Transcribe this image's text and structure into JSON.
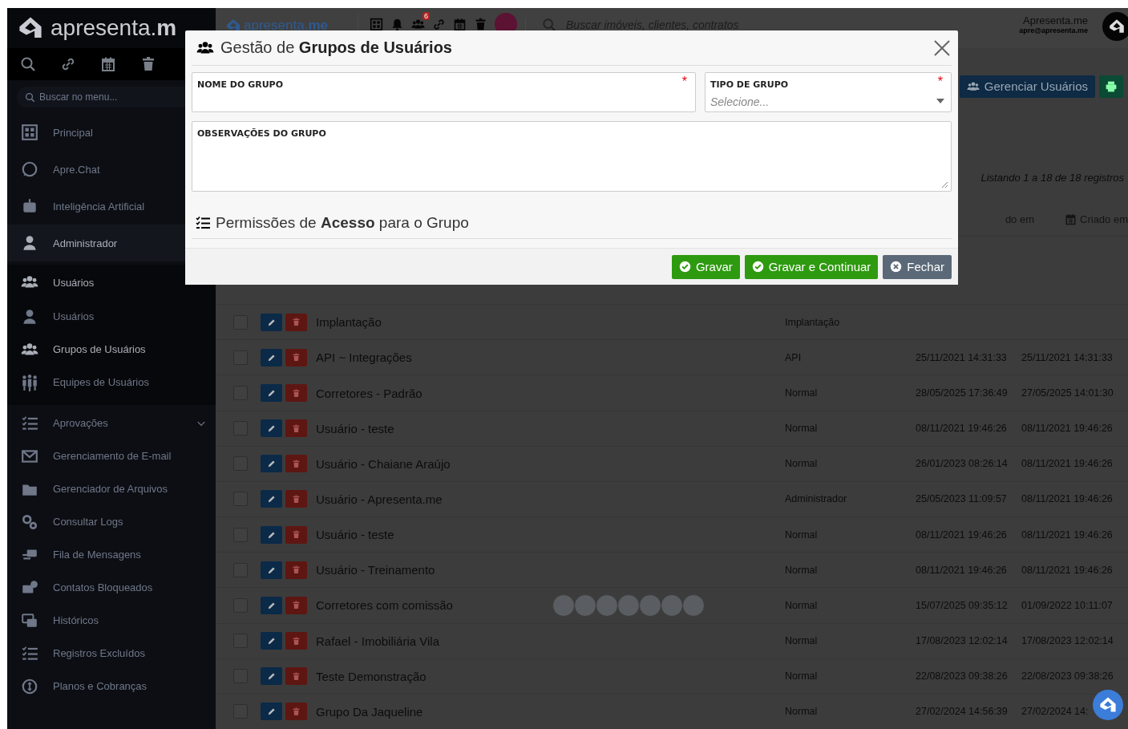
{
  "sidebar": {
    "logo": "apresenta.**m**",
    "search": {
      "placeholder": "Buscar no menu..."
    },
    "items": [
      {
        "kind": "link",
        "label": "Principal",
        "selected": false
      },
      {
        "kind": "link",
        "label": "Apre.Chat",
        "selected": false
      },
      {
        "kind": "link",
        "label": "Inteligência Artificial",
        "selected": false
      },
      {
        "kind": "link",
        "label": "Administrador",
        "selected": true
      },
      {
        "kind": "group",
        "label": "Usuários",
        "expanded": true,
        "children": [
          {
            "label": "Usuários",
            "selected": false
          },
          {
            "label": "Grupos de Usuários",
            "selected": true
          },
          {
            "label": "Equipes de Usuários",
            "selected": false
          }
        ]
      },
      {
        "kind": "group",
        "label": "Aprovações",
        "expanded": false
      },
      {
        "kind": "link",
        "label": "Gerenciamento de E-mail",
        "selected": false
      },
      {
        "kind": "link",
        "label": "Gerenciador de Arquivos",
        "selected": false
      },
      {
        "kind": "link",
        "label": "Consultar Logs",
        "selected": false
      },
      {
        "kind": "link",
        "label": "Fila de Mensagens",
        "selected": false
      },
      {
        "kind": "link",
        "label": "Contatos Bloqueados",
        "selected": false
      },
      {
        "kind": "link",
        "label": "Históricos",
        "selected": false
      },
      {
        "kind": "link",
        "label": "Registros Excluídos",
        "selected": false
      },
      {
        "kind": "link",
        "label": "Planos e Cobranças",
        "selected": false
      }
    ]
  },
  "topbar": {
    "logo": "apresenta.**me**",
    "notification_count": "6",
    "search": {
      "placeholder": "Buscar imóveis, clientes, contratos"
    },
    "user": {
      "name": "Apresenta.me",
      "email": "apre@apresenta.me"
    }
  },
  "toolbar": {
    "buttons": [
      {
        "label": "Gerenciar Usuários"
      }
    ]
  },
  "listing_info": "Listando 1 a 18 de 18 registros",
  "table": {
    "columns": [
      "do em",
      "Criado em"
    ],
    "rows": [
      {
        "checked": false,
        "name": "Implantação",
        "photos": false,
        "type": "Implantação"
      },
      {
        "checked": false,
        "name": "API ~ Integrações",
        "photos": false,
        "type": "API",
        "updated": "25/11/2021 14:31:33",
        "created": "25/11/2021 14:31:33"
      },
      {
        "checked": false,
        "name": "Corretores - Padrão",
        "photos": false,
        "type": "Normal",
        "updated": "28/05/2025 17:36:49",
        "created": "27/05/2025 14:01:30"
      },
      {
        "checked": false,
        "name": "Usuário - teste",
        "photos": false,
        "type": "Normal",
        "updated": "08/11/2021 19:46:26",
        "created": "08/11/2021 19:46:26"
      },
      {
        "checked": false,
        "name": "Usuário - Chaiane Araújo",
        "photos": false,
        "type": "Normal",
        "updated": "26/01/2023 08:26:14",
        "created": "08/11/2021 19:46:26"
      },
      {
        "checked": false,
        "name": "Usuário - Apresenta.me",
        "photos": false,
        "type": "Administrador",
        "updated": "25/05/2023 11:09:57",
        "created": "08/11/2021 19:46:26"
      },
      {
        "checked": false,
        "name": "Usuário - teste",
        "photos": false,
        "type": "Normal",
        "updated": "08/11/2021 19:46:26",
        "created": "08/11/2021 19:46:26"
      },
      {
        "checked": false,
        "name": "Usuário - Treinamento",
        "photos": false,
        "type": "Normal",
        "updated": "08/11/2021 19:46:26",
        "created": "08/11/2021 19:46:26"
      },
      {
        "checked": false,
        "name": "Corretores com comissão",
        "photos": true,
        "type": "Normal",
        "updated": "15/07/2025 09:35:12",
        "created": "01/09/2022 10:11:07"
      },
      {
        "checked": false,
        "name": "Rafael - Imobiliária Vila",
        "photos": false,
        "type": "Normal",
        "updated": "17/08/2023 12:02:14",
        "created": "17/08/2023 12:02:14"
      },
      {
        "checked": false,
        "name": "Teste Demonstração",
        "photos": false,
        "type": "Normal",
        "updated": "22/08/2023 09:38:26",
        "created": "22/08/2023 09:38:26"
      },
      {
        "checked": false,
        "name": "Grupo Da Jaqueline",
        "photos": false,
        "type": "Normal",
        "updated": "27/02/2024 14:56:39",
        "created": "27/02/2024 14:"
      }
    ]
  },
  "modal": {
    "title": "Gestão de **Grupos de Usuários**",
    "fields": [
      {
        "kind": "text",
        "label": "NOME DO GRUPO",
        "required_mark": "*"
      },
      {
        "kind": "select",
        "label": "TIPO DE GRUPO",
        "required_mark": "*",
        "placeholder": "Selecione..."
      },
      {
        "kind": "textarea",
        "label": "OBSERVAÇÕES DO GRUPO"
      }
    ],
    "section_title": "Permissões de **Acesso** para o Grupo",
    "buttons": [
      {
        "kind": "primary",
        "label": "Gravar"
      },
      {
        "kind": "primary",
        "label": "Gravar e Continuar"
      },
      {
        "kind": "secondary",
        "label": "Fechar"
      }
    ]
  }
}
